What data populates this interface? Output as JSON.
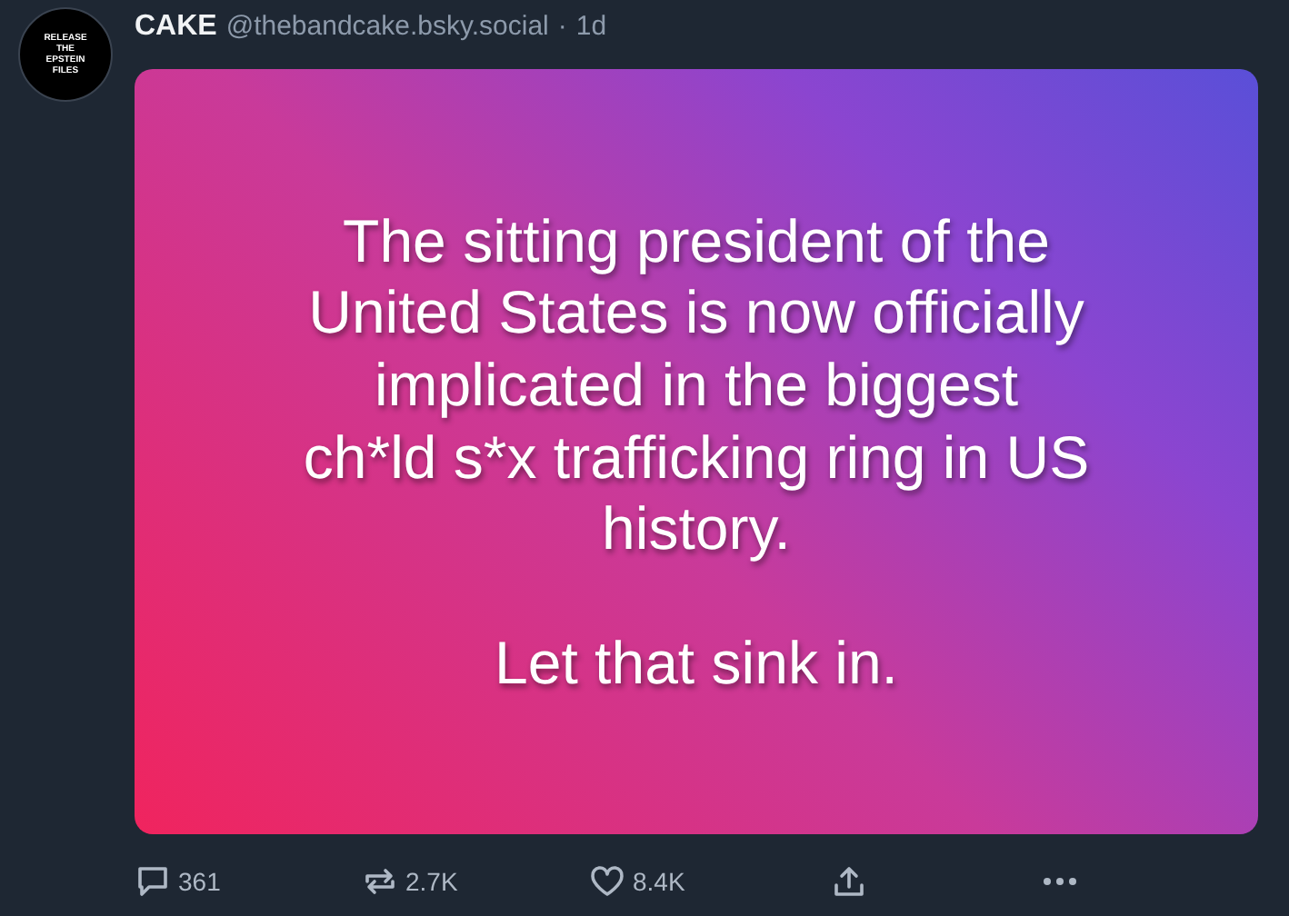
{
  "post": {
    "avatar": {
      "lines": [
        "RELEASE",
        "THE",
        "EPSTEIN",
        "FILES"
      ]
    },
    "display_name": "CAKE",
    "handle": "@thebandcake.bsky.social",
    "separator": "·",
    "age": "1d",
    "image_text": [
      {
        "lines": [
          "The sitting president of the",
          "United States is now officially",
          "implicated in the biggest",
          "ch*ld s*x trafficking ring in US",
          "history."
        ]
      },
      {
        "lines": [
          "Let that sink in."
        ]
      }
    ],
    "actions": [
      {
        "kind": "reply",
        "count": "361"
      },
      {
        "kind": "repost",
        "count": "2.7K"
      },
      {
        "kind": "like",
        "count": "8.4K"
      },
      {
        "kind": "share"
      },
      {
        "kind": "more"
      }
    ]
  }
}
